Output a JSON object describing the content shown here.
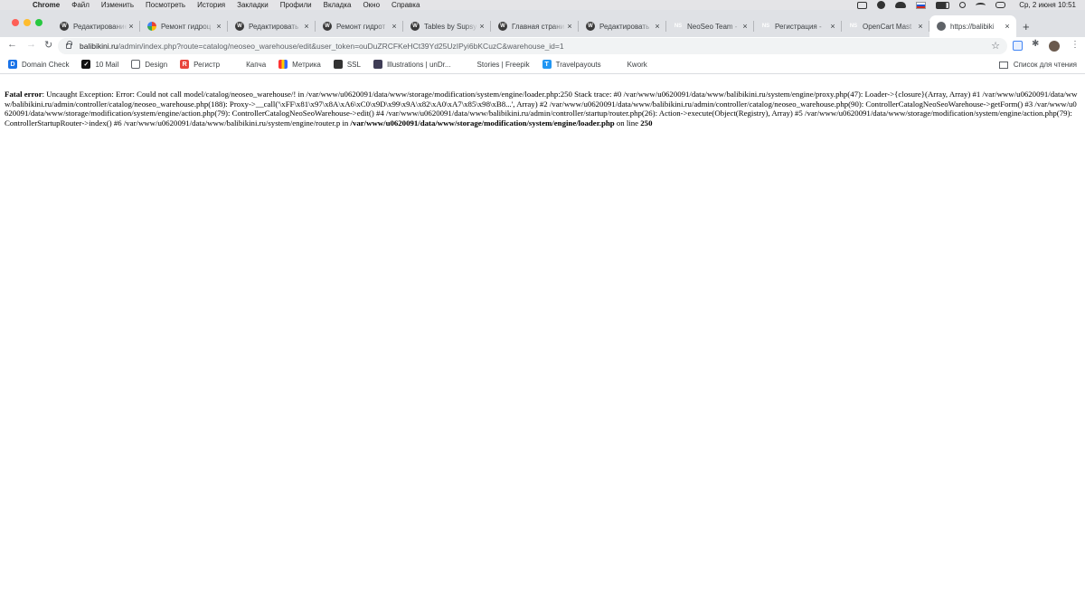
{
  "menubar": {
    "app_name": "Chrome",
    "items": [
      "Файл",
      "Изменить",
      "Посмотреть",
      "История",
      "Закладки",
      "Профили",
      "Вкладка",
      "Окно",
      "Справка"
    ],
    "datetime": "Ср, 2 июня  10:51"
  },
  "tabs": [
    {
      "title": "Редактирование",
      "icon": "wordpress-icon"
    },
    {
      "title": "Ремонт гидроц",
      "icon": "google-icon"
    },
    {
      "title": "Редактировать",
      "icon": "wordpress-icon"
    },
    {
      "title": "Ремонт гидрот",
      "icon": "wordpress-icon"
    },
    {
      "title": "Tables by Supsy",
      "icon": "wordpress-icon"
    },
    {
      "title": "Главная страни",
      "icon": "wordpress-icon"
    },
    {
      "title": "Редактировать",
      "icon": "wordpress-icon"
    },
    {
      "title": "NeoSeo Team -",
      "icon": "neoseo-icon"
    },
    {
      "title": "Регистрация -",
      "icon": "neoseo-icon"
    },
    {
      "title": "OpenCart Mast",
      "icon": "neoseo-icon"
    },
    {
      "title": "https://balibiki",
      "icon": "globe-icon",
      "active": true
    }
  ],
  "address": {
    "host": "balibikini.ru",
    "path": "/admin/index.php?route=catalog/neoseo_warehouse/edit&user_token=ouDuZRCFKeHCt39Yd25UzIPyi6bKCuzC&warehouse_id=1"
  },
  "bookmarks": [
    {
      "label": "Domain Check",
      "icon": "d"
    },
    {
      "label": "10 Mail",
      "icon": "10"
    },
    {
      "label": "Design",
      "icon": "folder"
    },
    {
      "label": "Регистр",
      "icon": "reg"
    },
    {
      "label": "Капча",
      "icon": "captcha"
    },
    {
      "label": "Метрика",
      "icon": "metrika"
    },
    {
      "label": "SSL",
      "icon": "ssl"
    },
    {
      "label": "Illustrations | unDr...",
      "icon": "undraw"
    },
    {
      "label": "Stories | Freepik",
      "icon": "freepik"
    },
    {
      "label": "Travelpayouts",
      "icon": "tp"
    },
    {
      "label": "Kwork",
      "icon": "kwork"
    }
  ],
  "reading_list": "Список для чтения",
  "error": {
    "label": "Fatal error",
    "message": ": Uncaught Exception: Error: Could not call model/catalog/neoseo_warehouse/! in /var/www/u0620091/data/www/storage/modification/system/engine/loader.php:250 Stack trace: #0 /var/www/u0620091/data/www/balibikini.ru/system/engine/proxy.php(47): Loader->{closure}(Array, Array) #1 /var/www/u0620091/data/www/balibikini.ru/admin/controller/catalog/neoseo_warehouse.php(188): Proxy->__call('\\xFF\\x81\\x97\\x8A\\xA6\\xC0\\x9D\\x99\\x9A\\x82\\xA0\\xA7\\x85\\x98\\xB8...', Array) #2 /var/www/u0620091/data/www/balibikini.ru/admin/controller/catalog/neoseo_warehouse.php(90): ControllerCatalogNeoSeoWarehouse->getForm() #3 /var/www/u0620091/data/www/storage/modification/system/engine/action.php(79): ControllerCatalogNeoSeoWarehouse->edit() #4 /var/www/u0620091/data/www/balibikini.ru/admin/controller/startup/router.php(26): Action->execute(Object(Registry), Array) #5 /var/www/u0620091/data/www/storage/modification/system/engine/action.php(79): ControllerStartupRouter->index() #6 /var/www/u0620091/data/www/balibikini.ru/system/engine/router.p in ",
    "file": "/var/www/u0620091/data/www/storage/modification/system/engine/loader.php",
    "on_line": " on line ",
    "line": "250"
  }
}
